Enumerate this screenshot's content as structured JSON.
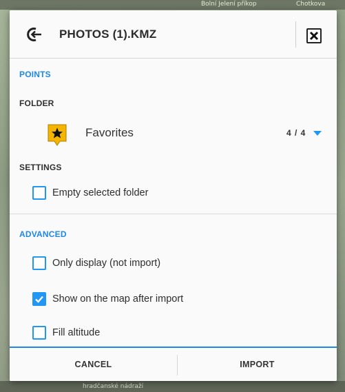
{
  "map": {
    "top_labels": [
      "Bolní Jelení příkop",
      "Chotkova"
    ],
    "bottom_label": "hradčanské nádraží"
  },
  "dialog": {
    "title": "PHOTOS (1).KMZ",
    "points_section": "POINTS",
    "folder_label": "FOLDER",
    "folder": {
      "name": "Favorites",
      "count": "4 / 4"
    },
    "settings_label": "SETTINGS",
    "settings_options": [
      {
        "label": "Empty selected folder",
        "checked": false
      }
    ],
    "advanced_section": "ADVANCED",
    "advanced_options": [
      {
        "label": "Only display (not import)",
        "checked": false
      },
      {
        "label": "Show on the map after import",
        "checked": true
      },
      {
        "label": "Fill altitude",
        "checked": false
      }
    ],
    "cancel_label": "CANCEL",
    "import_label": "IMPORT"
  },
  "icons": {
    "title": "import-icon",
    "close": "close-icon",
    "folder": "star-folder-icon",
    "dropdown": "dropdown-arrow-icon",
    "check": "checkmark-icon"
  },
  "colors": {
    "accent": "#1e88e5",
    "checkbox": "#2196f3",
    "folder_icon": "#f4b400"
  }
}
